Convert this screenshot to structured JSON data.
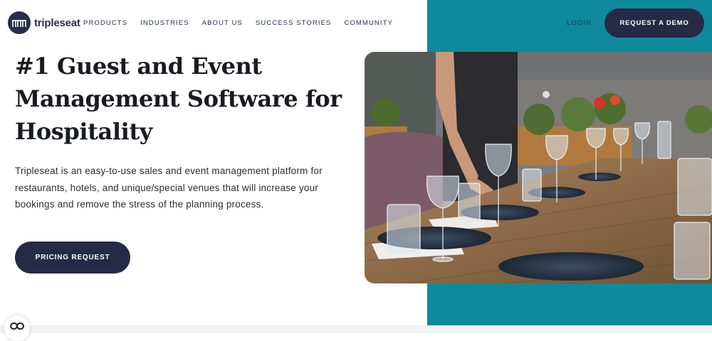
{
  "brand": {
    "name": "tripleseat"
  },
  "nav": {
    "items": [
      {
        "label": "PRODUCTS"
      },
      {
        "label": "INDUSTRIES"
      },
      {
        "label": "ABOUT US"
      },
      {
        "label": "SUCCESS STORIES"
      },
      {
        "label": "COMMUNITY"
      }
    ],
    "login_label": "LOGIN",
    "demo_label": "REQUEST A DEMO"
  },
  "hero": {
    "title": "#1 Guest and Event Management Software for Hospitality",
    "description": "Tripleseat is an easy-to-use sales and event management platform for restaurants, hotels, and unique/special venues that will increase your bookings and remove the stress of the planning process.",
    "cta_label": "PRICING REQUEST"
  },
  "colors": {
    "teal_panel": "#0e8a9c",
    "navy": "#262a45"
  },
  "icons": {
    "logo": "tripleseat-logo-icon",
    "chat": "chat-link-icon"
  }
}
